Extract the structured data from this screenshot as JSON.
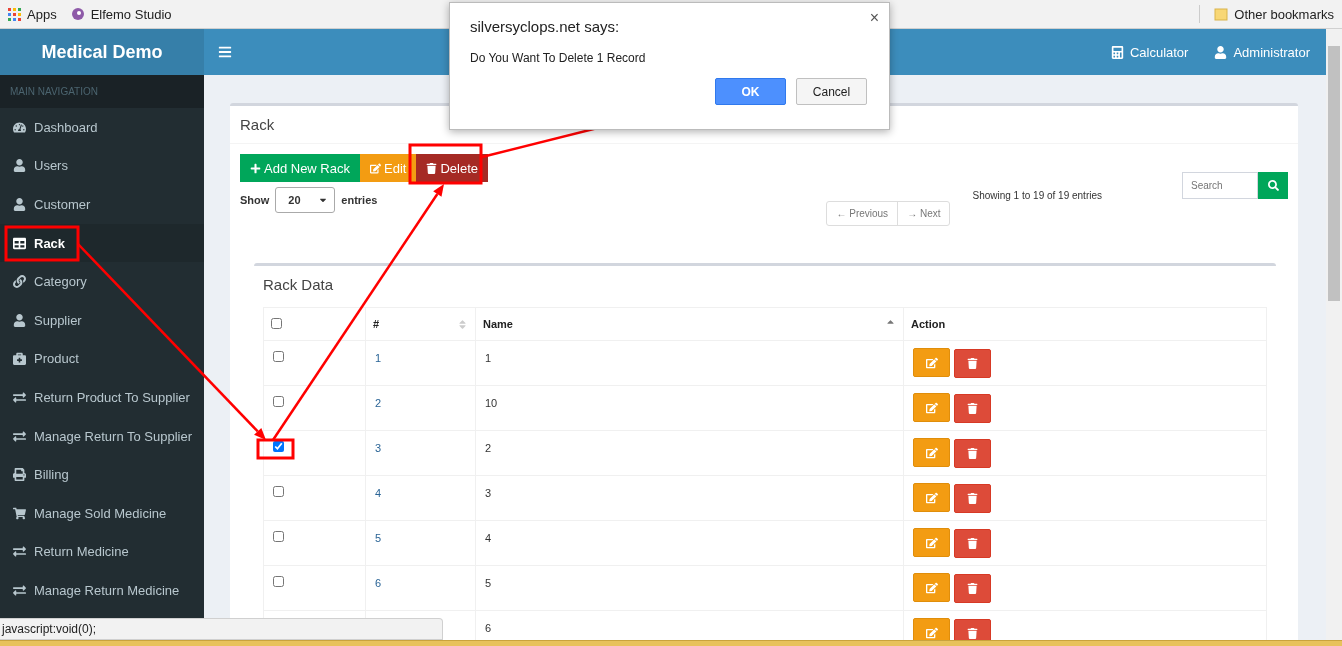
{
  "browser": {
    "bookmarks": [
      {
        "label": "Apps",
        "kind": "apps"
      },
      {
        "label": "Elfemo Studio",
        "kind": "site"
      }
    ],
    "other_bookmarks": "Other bookmarks"
  },
  "header": {
    "brand": "Medical Demo",
    "links": [
      {
        "label": "Calculator",
        "kind": "calculator"
      },
      {
        "label": "Administrator",
        "kind": "user"
      }
    ]
  },
  "sidebar": {
    "heading": "MAIN NAVIGATION",
    "items": [
      {
        "label": "Dashboard",
        "kind": "dashboard",
        "selected": false
      },
      {
        "label": "Users",
        "kind": "user",
        "selected": false
      },
      {
        "label": "Customer",
        "kind": "user",
        "selected": false
      },
      {
        "label": "Rack",
        "kind": "table",
        "selected": true
      },
      {
        "label": "Category",
        "kind": "link",
        "selected": false
      },
      {
        "label": "Supplier",
        "kind": "user",
        "selected": false
      },
      {
        "label": "Product",
        "kind": "medkit",
        "selected": false
      },
      {
        "label": "Return Product To Supplier",
        "kind": "exchange",
        "selected": false
      },
      {
        "label": "Manage Return To Supplier",
        "kind": "exchange",
        "selected": false
      },
      {
        "label": "Billing",
        "kind": "print",
        "selected": false
      },
      {
        "label": "Manage Sold Medicine",
        "kind": "cart",
        "selected": false
      },
      {
        "label": "Return Medicine",
        "kind": "exchange",
        "selected": false
      },
      {
        "label": "Manage Return Medicine",
        "kind": "exchange",
        "selected": false
      }
    ]
  },
  "panel": {
    "title": "Rack",
    "buttons": [
      {
        "label": "Add New Rack",
        "kind": "add"
      },
      {
        "label": "Edit",
        "kind": "edit"
      },
      {
        "label": "Delete",
        "kind": "delete"
      }
    ],
    "show_label": "Show",
    "page_size": "20",
    "entries_label": "entries",
    "pagination": [
      "← Previous",
      "→ Next"
    ],
    "info": "Showing 1 to 19 of 19 entries",
    "search": {
      "placeholder": "Search"
    }
  },
  "table": {
    "title": "Rack Data",
    "header_checked": false,
    "columns": [
      {
        "label": "#",
        "kind": "sortable"
      },
      {
        "label": "Name",
        "kind": "sorted"
      },
      {
        "label": "Action",
        "kind": "plain"
      }
    ],
    "rows": [
      {
        "number": "1",
        "name": "1",
        "checked": false
      },
      {
        "number": "2",
        "name": "10",
        "checked": false
      },
      {
        "number": "3",
        "name": "2",
        "checked": true
      },
      {
        "number": "4",
        "name": "3",
        "checked": false
      },
      {
        "number": "5",
        "name": "4",
        "checked": false
      },
      {
        "number": "6",
        "name": "5",
        "checked": false
      },
      {
        "name": "6"
      }
    ]
  },
  "dialog": {
    "title": "silversyclops.net says:",
    "close": "×",
    "message": "Do You Want To Delete 1 Record",
    "buttons": [
      {
        "label": "OK",
        "kind": "primary"
      },
      {
        "label": "Cancel",
        "kind": "default"
      }
    ]
  },
  "status_url": "javascript:void(0);"
}
